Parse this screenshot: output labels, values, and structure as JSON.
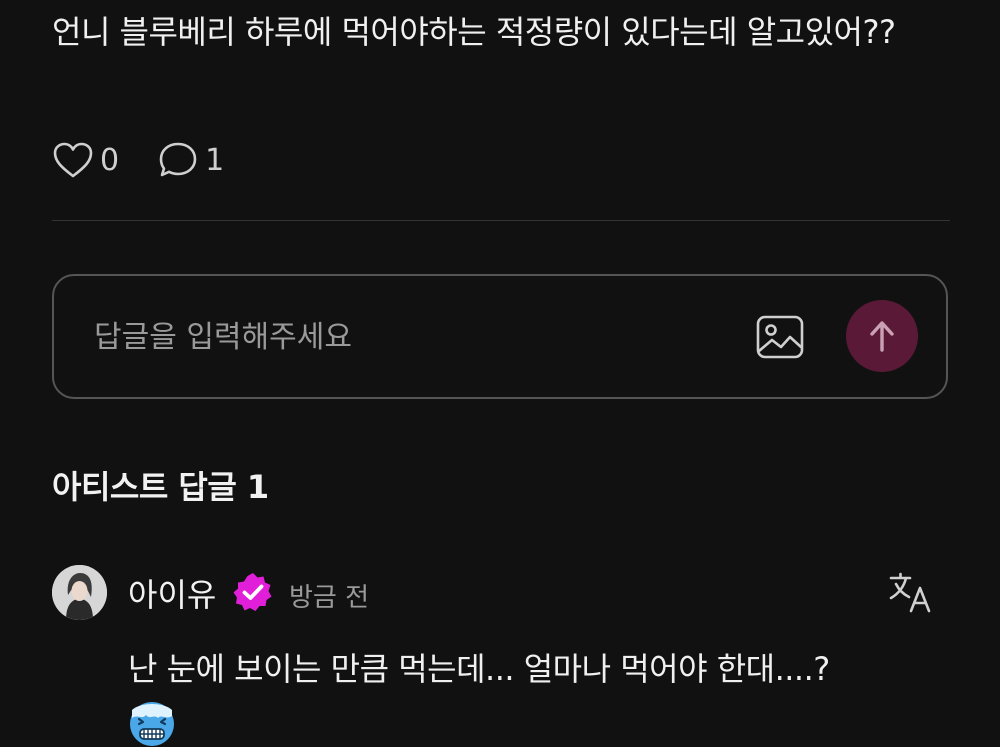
{
  "post": {
    "text": "언니 블루베리 하루에 먹어야하는 적정량이 있다는데 알고있어??",
    "like_count": "0",
    "comment_count": "1"
  },
  "reply": {
    "placeholder": "답글을 입력해주세요",
    "send_button_color": "#5a1a37"
  },
  "artist_replies": {
    "title": "아티스트 답글 1",
    "comments": [
      {
        "author": "아이유",
        "time": "방금 전",
        "text": "난 눈에 보이는 만큼 먹는데... 얼마나 먹어야 한대....?",
        "badge_color": "#e21fd8"
      }
    ]
  },
  "icons": {
    "like": "heart-icon",
    "comment": "speech-bubble-icon",
    "image": "image-icon",
    "send": "arrow-up-icon",
    "verified": "verified-badge-icon",
    "translate": "translate-icon",
    "emoji": "freezing-face-emoji"
  }
}
